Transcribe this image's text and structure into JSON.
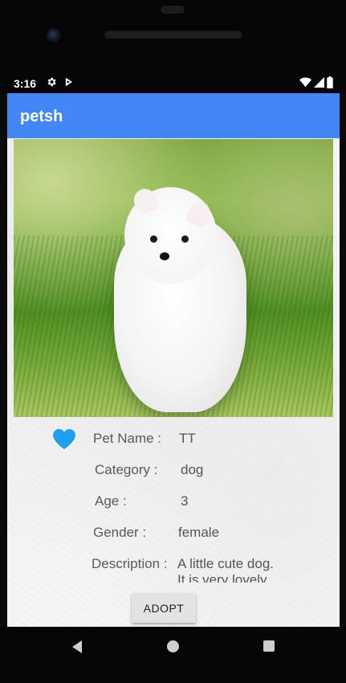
{
  "status_bar": {
    "time": "3:16",
    "icons": [
      "gear-icon",
      "play-protect-icon",
      "wifi-icon",
      "signal-icon",
      "battery-icon"
    ]
  },
  "app_bar": {
    "title": "petsh",
    "color": "#4285f4"
  },
  "pet": {
    "photo_subject": "white fluffy puppy on grass",
    "favorite_icon": "heart-icon",
    "favorite_color": "#1ea0ee",
    "fields": [
      {
        "label": "Pet Name :",
        "value": "TT"
      },
      {
        "label": "Category :",
        "value": "dog"
      },
      {
        "label": "Age :",
        "value": "3"
      },
      {
        "label": "Gender :",
        "value": "female"
      },
      {
        "label": "Description :",
        "value_lines": [
          "A little cute dog.",
          "It is very lovely."
        ]
      }
    ]
  },
  "actions": {
    "adopt_label": "ADOPT"
  },
  "nav_bar": {
    "icons": [
      "back-icon",
      "home-icon",
      "recents-icon"
    ]
  }
}
